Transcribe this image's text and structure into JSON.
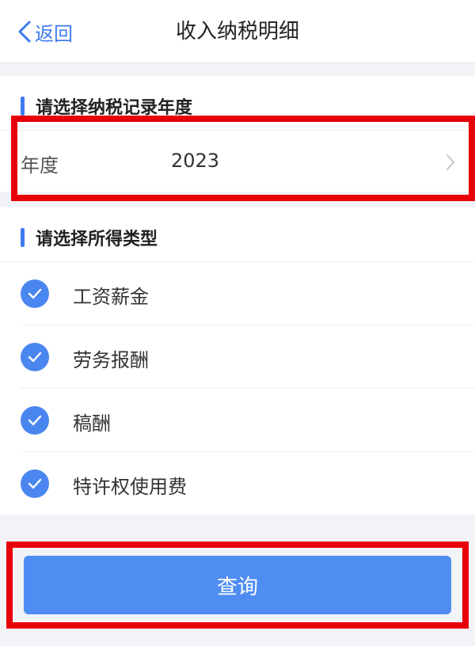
{
  "navbar": {
    "back_label": "返回",
    "title": "收入纳税明细"
  },
  "year_section": {
    "heading": "请选择纳税记录年度",
    "field_label": "年度",
    "field_value": "2023"
  },
  "type_section": {
    "heading": "请选择所得类型",
    "items": [
      {
        "label": "工资薪金",
        "checked": true
      },
      {
        "label": "劳务报酬",
        "checked": true
      },
      {
        "label": "稿酬",
        "checked": true
      },
      {
        "label": "特许权使用费",
        "checked": true
      }
    ]
  },
  "actions": {
    "query_label": "查询"
  },
  "colors": {
    "accent": "#3f7bf0",
    "button": "#4f8df2",
    "highlight": "#e8000a",
    "background": "#f2f3f7"
  }
}
